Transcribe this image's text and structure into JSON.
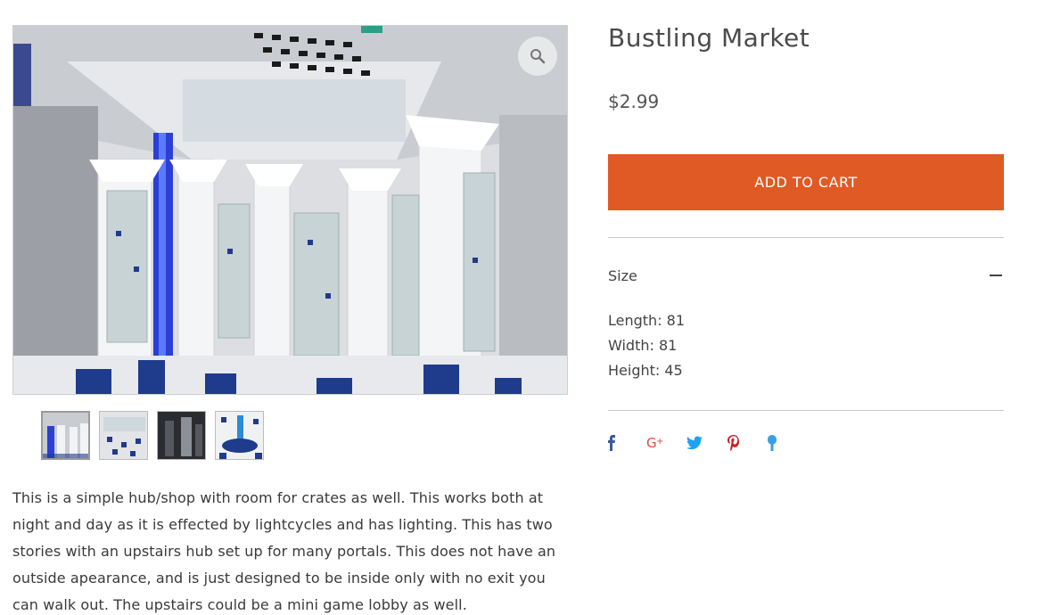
{
  "product": {
    "title": "Bustling Market",
    "price": "$2.99",
    "add_to_cart_label": "ADD TO CART",
    "info_section": {
      "title": "Size",
      "lines": [
        "Length: 81",
        "Width: 81",
        "Height: 45"
      ]
    },
    "description": "This is a simple hub/shop with room for crates as well. This works both at night and day as it is effected by lightcycles and has lighting. This has two stories with an upstairs hub set up for many portals. This does not have an outside apearance, and is just designed to be inside only with no exit you can walk out.  The upstairs could be a mini game lobby as well."
  },
  "gallery": {
    "thumbnail_count": 4,
    "active_index": 0
  },
  "share": {
    "icons": [
      "facebook-icon",
      "google-plus-icon",
      "twitter-icon",
      "pinterest-icon",
      "fancy-icon"
    ],
    "colors": {
      "facebook": "#3b5998",
      "google_plus": "#dd4b39",
      "twitter": "#1da1f2",
      "pinterest": "#cb2027",
      "fancy": "#3aa0e6"
    }
  },
  "colors": {
    "accent": "#e05a25",
    "text": "#444444"
  }
}
